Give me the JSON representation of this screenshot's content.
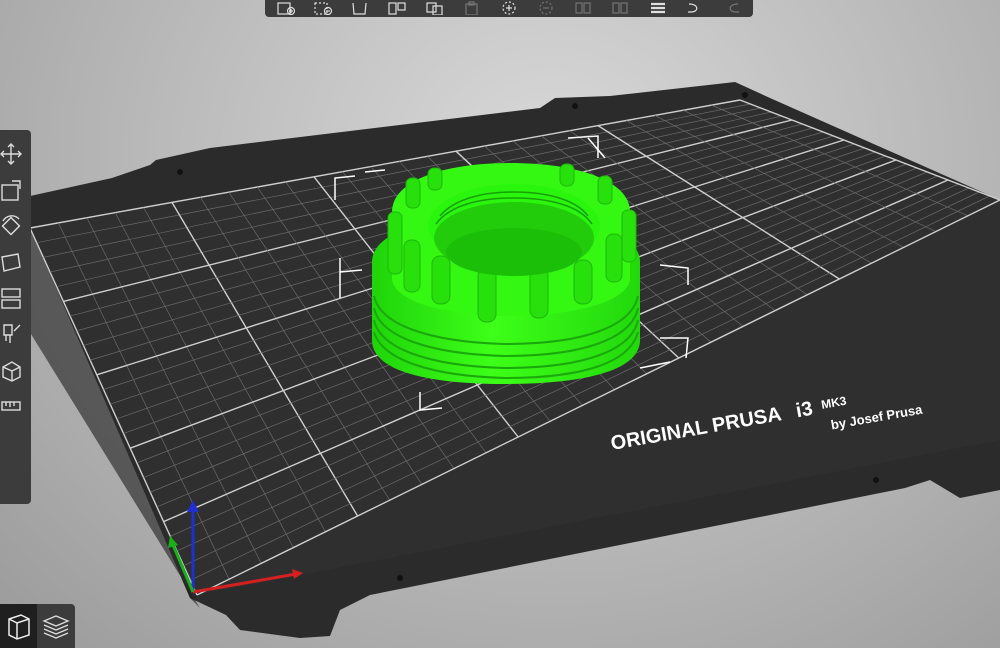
{
  "bed": {
    "title_line1": "ORIGINAL PRUSA",
    "title_model": "i3",
    "title_variant": "MK3",
    "subtitle": "by Josef Prusa"
  },
  "top_toolbar": {
    "buttons": [
      {
        "icon": "add-object-icon",
        "enabled": true
      },
      {
        "icon": "delete-object-icon",
        "enabled": true
      },
      {
        "icon": "delete-all-icon",
        "enabled": true
      },
      {
        "icon": "arrange-icon",
        "enabled": true
      },
      {
        "icon": "copy-icon",
        "enabled": true
      },
      {
        "icon": "paste-icon",
        "enabled": false
      },
      {
        "icon": "add-instance-icon",
        "enabled": true
      },
      {
        "icon": "remove-instance-icon",
        "enabled": false
      },
      {
        "icon": "split-objects-icon",
        "enabled": false
      },
      {
        "icon": "split-parts-icon",
        "enabled": false
      },
      {
        "icon": "layers-editing-icon",
        "enabled": true
      },
      {
        "icon": "undo-icon",
        "enabled": true
      },
      {
        "icon": "redo-icon",
        "enabled": false
      }
    ]
  },
  "left_toolbar": {
    "tools": [
      "move-icon",
      "scale-icon",
      "rotate-icon",
      "place-on-face-icon",
      "cut-icon",
      "paint-supports-icon",
      "seam-paint-icon",
      "measure-icon"
    ]
  },
  "view_toggle": {
    "active": "3d-view"
  },
  "colors": {
    "model": "#2ef00a",
    "bed": "#2b2b2b",
    "toolbar": "#3c3c3c",
    "axis_x": "#d42020",
    "axis_y": "#18b018",
    "axis_z": "#1f2fd0"
  }
}
